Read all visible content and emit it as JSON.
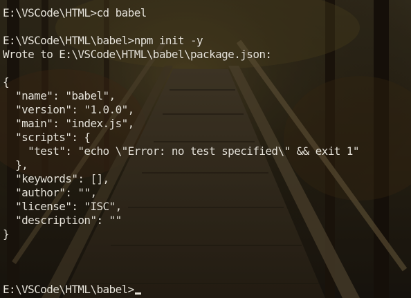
{
  "console": {
    "lines": [
      "E:\\VSCode\\HTML>cd babel",
      "",
      "E:\\VSCode\\HTML\\babel>npm init -y",
      "Wrote to E:\\VSCode\\HTML\\babel\\package.json:",
      "",
      "{",
      "  \"name\": \"babel\",",
      "  \"version\": \"1.0.0\",",
      "  \"main\": \"index.js\",",
      "  \"scripts\": {",
      "    \"test\": \"echo \\\"Error: no test specified\\\" && exit 1\"",
      "  },",
      "  \"keywords\": [],",
      "  \"author\": \"\",",
      "  \"license\": \"ISC\",",
      "  \"description\": \"\"",
      "}",
      "",
      "",
      "",
      "E:\\VSCode\\HTML\\babel>"
    ],
    "text_color": "#e8e4da"
  }
}
